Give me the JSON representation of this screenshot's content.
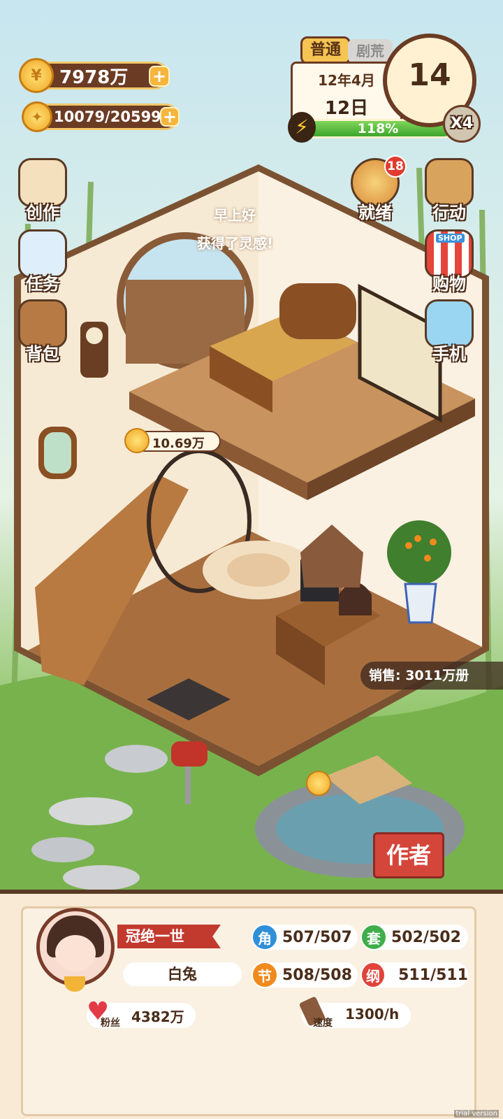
{
  "resources": {
    "coins": "7978万",
    "inspiration": "10079/20599",
    "coin_symbol": "¥"
  },
  "calendar": {
    "difficulty": "普通",
    "hidden_tab": "剧荒",
    "month": "12年4月",
    "day": "12日",
    "energy_percent": "118%",
    "clock_number": "14",
    "speed_multiplier": "X4"
  },
  "left_menu": [
    {
      "label": "创作",
      "icon": "book-icon"
    },
    {
      "label": "任务",
      "icon": "checklist-icon"
    },
    {
      "label": "背包",
      "icon": "backpack-icon"
    }
  ],
  "right_menu": [
    {
      "label": "就绪",
      "icon": "compass-icon",
      "badge": "18"
    },
    {
      "label": "行动",
      "icon": "door-icon"
    },
    {
      "label": "购物",
      "icon": "shop-icon",
      "sign": "SHOP"
    },
    {
      "label": "手机",
      "icon": "phone-icon"
    }
  ],
  "scene": {
    "greeting": "早上好",
    "event": "获得了灵感!",
    "floating_coins": "10.69万",
    "sales": "销售: 3011万册",
    "author_button": "作者"
  },
  "profile": {
    "title": "冠绝一世",
    "name": "白兔",
    "fans_label": "粉丝",
    "fans": "4382万",
    "speed_label": "速度",
    "speed": "1300/h"
  },
  "stats": [
    {
      "badge": "角",
      "value": "507/507",
      "color": "#2f8fd8"
    },
    {
      "badge": "套",
      "value": "502/502",
      "color": "#3fae4a"
    },
    {
      "badge": "节",
      "value": "508/508",
      "color": "#f08a1c"
    },
    {
      "badge": "纲",
      "value": "511/511",
      "color": "#e0443a"
    }
  ],
  "watermark": "trial version"
}
